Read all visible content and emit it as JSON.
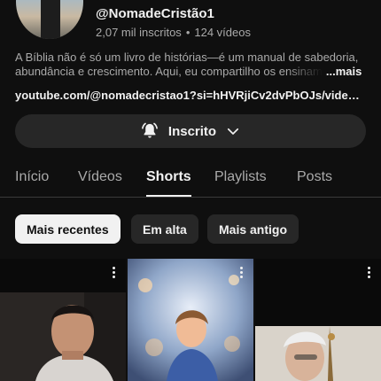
{
  "channel": {
    "handle": "@NomadeCristão1",
    "subscribers": "2,07 mil inscritos",
    "separator": "•",
    "videos": "124 vídeos",
    "description_line1": "A Bíblia não é só um livro de histórias—é um manual de sabedoria,",
    "description_line2": "abundância e crescimento. Aqui, eu compartilho os ensinam",
    "more_label": "...mais",
    "link": "youtube.com/@nomadecristao1?si=hHVRjiCv2dvPbOJs/videos..."
  },
  "subscribe_button": {
    "label": "Inscrito",
    "bell_icon": "bell-ringing-icon",
    "chevron_icon": "chevron-down-icon"
  },
  "tabs": [
    "Início",
    "Vídeos",
    "Shorts",
    "Playlists",
    "Posts"
  ],
  "active_tab": "Shorts",
  "chips": [
    "Mais recentes",
    "Em alta",
    "Mais antigo"
  ],
  "active_chip": "Mais recentes",
  "colors": {
    "background": "#0f0f0f",
    "surface": "#272727",
    "text_primary": "#f1f1f1",
    "text_secondary": "#aaaaaa"
  }
}
